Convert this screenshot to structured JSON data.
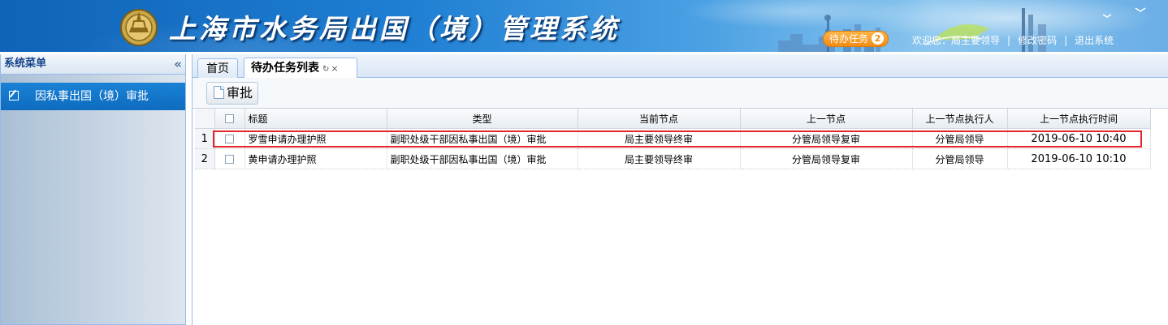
{
  "header": {
    "title": "上海市水务局出国（境）管理系统",
    "todo_label": "待办任务",
    "todo_count": "2",
    "welcome": "欢迎您：局主要领导",
    "change_password": "修改密码",
    "logout": "退出系统"
  },
  "sidebar": {
    "title": "系统菜单",
    "collapse_icon": "«",
    "items": [
      {
        "label": "因私事出国（境）审批",
        "icon": "edit-icon"
      }
    ]
  },
  "tabs": [
    {
      "label": "首页"
    },
    {
      "label": "待办任务列表",
      "refresh_icon": "↻",
      "close_icon": "×"
    }
  ],
  "toolbar": {
    "approve_label": "审批"
  },
  "table": {
    "columns": [
      "标题",
      "类型",
      "当前节点",
      "上一节点",
      "上一节点执行人",
      "上一节点执行时间"
    ],
    "rows": [
      {
        "num": "1",
        "title": "罗雪申请办理护照",
        "type": "副职处级干部因私事出国（境）审批",
        "current_node": "局主要领导终审",
        "prev_node": "分管局领导复审",
        "prev_executor": "分管局领导",
        "prev_time": "2019-06-10 10:40",
        "highlighted": true
      },
      {
        "num": "2",
        "title": "黄申请办理护照",
        "type": "副职处级干部因私事出国（境）审批",
        "current_node": "局主要领导终审",
        "prev_node": "分管局领导复审",
        "prev_executor": "分管局领导",
        "prev_time": "2019-06-10 10:10",
        "highlighted": false
      }
    ]
  },
  "colors": {
    "header_blue": "#1f7fd3",
    "menu_active": "#0e6cbf",
    "todo_orange": "#f08a12",
    "highlight_red": "#e3262d"
  }
}
